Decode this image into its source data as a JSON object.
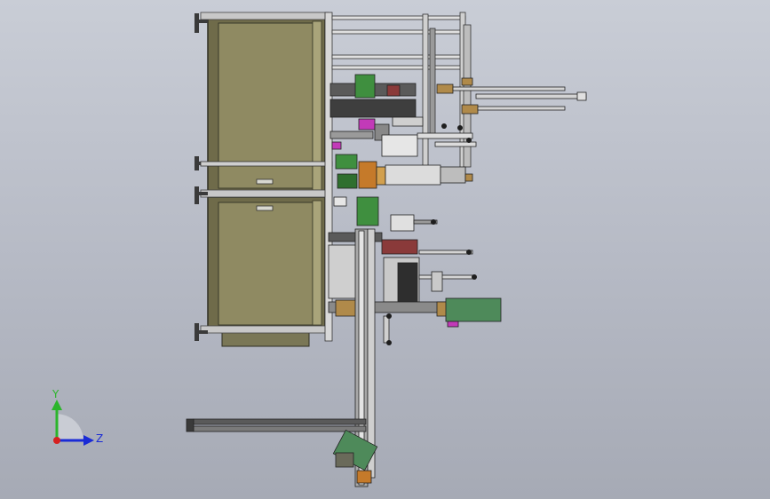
{
  "triad": {
    "y_label": "Y",
    "z_label": "Z",
    "y_color": "#2bb52b",
    "z_color": "#1a2bd6",
    "x_color": "#d62020"
  },
  "colors": {
    "cabinet": "#9a9468",
    "cabinet_panel": "#8b8763",
    "frame": "#d6d6d6",
    "dark_steel": "#4c4c4c",
    "accent_green": "#3f8f3f",
    "accent_magenta": "#c23ab8",
    "brass": "#b08a4a",
    "motor_green": "#4e8a5a"
  }
}
